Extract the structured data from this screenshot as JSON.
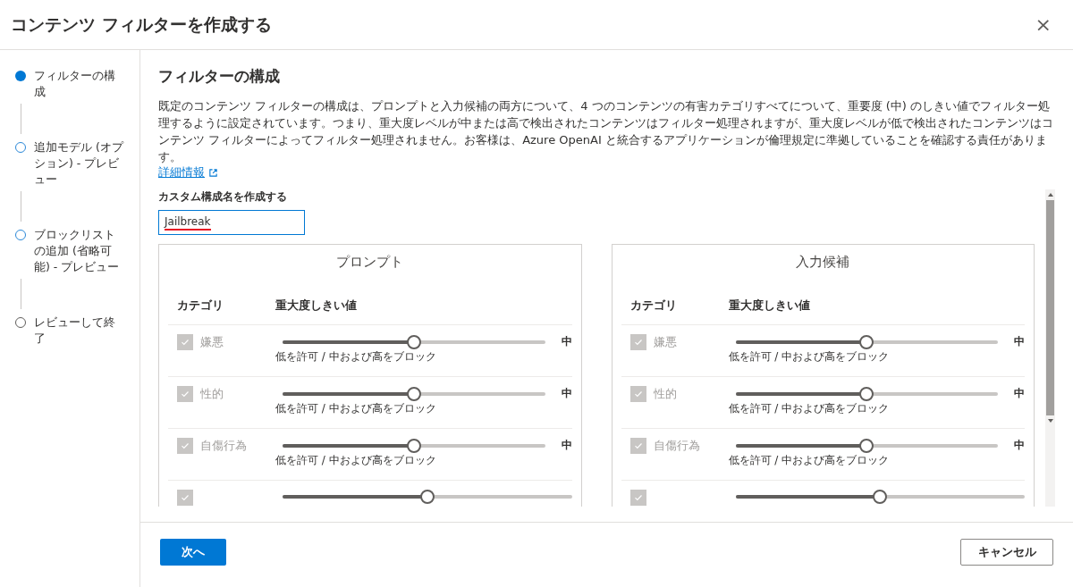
{
  "dialog": {
    "title": "コンテンツ フィルターを作成する",
    "close_icon": "×"
  },
  "steps": [
    {
      "label": "フィルターの構成",
      "selected": true,
      "disabled": false
    },
    {
      "label": "追加モデル (オプション) - プレビュー",
      "selected": false,
      "disabled": false
    },
    {
      "label": "ブロックリストの追加 (省略可能) - プレビュー",
      "selected": false,
      "disabled": false
    },
    {
      "label": "レビューして終了",
      "selected": false,
      "disabled": true
    }
  ],
  "section": {
    "title": "フィルターの構成",
    "description": "既定のコンテンツ フィルターの構成は、プロンプトと入力候補の両方について、4 つのコンテンツの有害カテゴリすべてについて、重要度 (中) のしきい値でフィルター処理するように設定されています。つまり、重大度レベルが中または高で検出されたコンテンツはフィルター処理されますが、重大度レベルが低で検出されたコンテンツはコンテンツ フィルターによってフィルター処理されません。お客様は、Azure OpenAI と統合するアプリケーションが倫理規定に準拠していることを確認する責任があります。",
    "link": "詳細情報"
  },
  "name_field": {
    "label": "カスタム構成名を作成する",
    "value": "Jailbreak"
  },
  "panels": [
    {
      "title": "プロンプト",
      "col_category": "カテゴリ",
      "col_threshold": "重大度しきい値",
      "rows": [
        {
          "category": "嫌悪",
          "checked": true,
          "disabled": true,
          "level": 0.5,
          "value": "中",
          "hint": "低を許可 / 中および高をブロック"
        },
        {
          "category": "性的",
          "checked": true,
          "disabled": true,
          "level": 0.5,
          "value": "中",
          "hint": "低を許可 / 中および高をブロック"
        },
        {
          "category": "自傷行為",
          "checked": true,
          "disabled": true,
          "level": 0.5,
          "value": "中",
          "hint": "低を許可 / 中および高をブロック"
        },
        {
          "checked": true,
          "disabled": true,
          "level": 0.5
        }
      ]
    },
    {
      "title": "入力候補",
      "col_category": "カテゴリ",
      "col_threshold": "重大度しきい値",
      "rows": [
        {
          "category": "嫌悪",
          "checked": true,
          "disabled": true,
          "level": 0.5,
          "value": "中",
          "hint": "低を許可 / 中および高をブロック"
        },
        {
          "category": "性的",
          "checked": true,
          "disabled": true,
          "level": 0.5,
          "value": "中",
          "hint": "低を許可 / 中および高をブロック"
        },
        {
          "category": "自傷行為",
          "checked": true,
          "disabled": true,
          "level": 0.5,
          "value": "中",
          "hint": "低を許可 / 中および高をブロック"
        },
        {
          "checked": true,
          "disabled": true,
          "level": 0.5
        }
      ]
    }
  ],
  "buttons": {
    "next": "次へ",
    "cancel": "キャンセル"
  }
}
